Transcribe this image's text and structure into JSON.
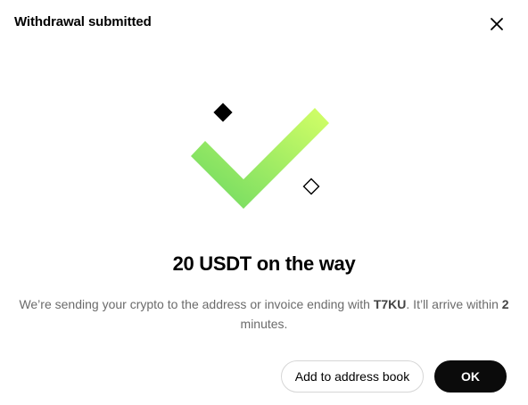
{
  "dialog": {
    "title": "Withdrawal submitted",
    "close_icon": "close-icon"
  },
  "illustration": {
    "icon": "checkmark-icon",
    "colors": {
      "check_top": "#d4ff66",
      "check_bottom": "#6ad862",
      "diamond_filled": "#000000",
      "diamond_outline": "#000000"
    }
  },
  "headline": "20 USDT on the way",
  "message": {
    "part1": "We’re sending your crypto to the address or invoice ending with ",
    "address_suffix": "T7KU",
    "part2": ". It’ll arrive within ",
    "minutes": "2",
    "part3": "minutes."
  },
  "actions": {
    "add_address_label": "Add to address book",
    "ok_label": "OK"
  },
  "colors": {
    "primary_button_bg": "#0b0b0b",
    "secondary_button_border": "#d6d6d6",
    "muted_text": "#6b6b6b"
  }
}
